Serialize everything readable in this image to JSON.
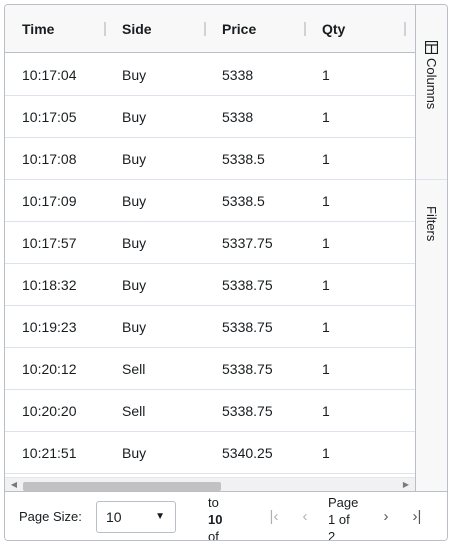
{
  "columns": [
    "Time",
    "Side",
    "Price",
    "Qty"
  ],
  "rows": [
    {
      "time": "10:17:04",
      "side": "Buy",
      "price": "5338",
      "qty": "1"
    },
    {
      "time": "10:17:05",
      "side": "Buy",
      "price": "5338",
      "qty": "1"
    },
    {
      "time": "10:17:08",
      "side": "Buy",
      "price": "5338.5",
      "qty": "1"
    },
    {
      "time": "10:17:09",
      "side": "Buy",
      "price": "5338.5",
      "qty": "1"
    },
    {
      "time": "10:17:57",
      "side": "Buy",
      "price": "5337.75",
      "qty": "1"
    },
    {
      "time": "10:18:32",
      "side": "Buy",
      "price": "5338.75",
      "qty": "1"
    },
    {
      "time": "10:19:23",
      "side": "Buy",
      "price": "5338.75",
      "qty": "1"
    },
    {
      "time": "10:20:12",
      "side": "Sell",
      "price": "5338.75",
      "qty": "1"
    },
    {
      "time": "10:20:20",
      "side": "Sell",
      "price": "5338.75",
      "qty": "1"
    },
    {
      "time": "10:21:51",
      "side": "Buy",
      "price": "5340.25",
      "qty": "1"
    }
  ],
  "side_bar": {
    "columns_label": "Columns",
    "filters_label": "Filters"
  },
  "paging": {
    "page_size_label": "Page Size:",
    "page_size_value": "10",
    "row_summary": {
      "to_word": "to",
      "to_value": "10",
      "of_word": "of"
    },
    "page_summary": {
      "page_word": "Page",
      "current": "1",
      "of_word": "of",
      "total": "2"
    }
  },
  "icons": {
    "first": "first-page-icon",
    "prev": "previous-page-icon",
    "next": "next-page-icon",
    "last": "last-page-icon",
    "columns": "columns-icon",
    "caret": "chevron-down-icon"
  }
}
